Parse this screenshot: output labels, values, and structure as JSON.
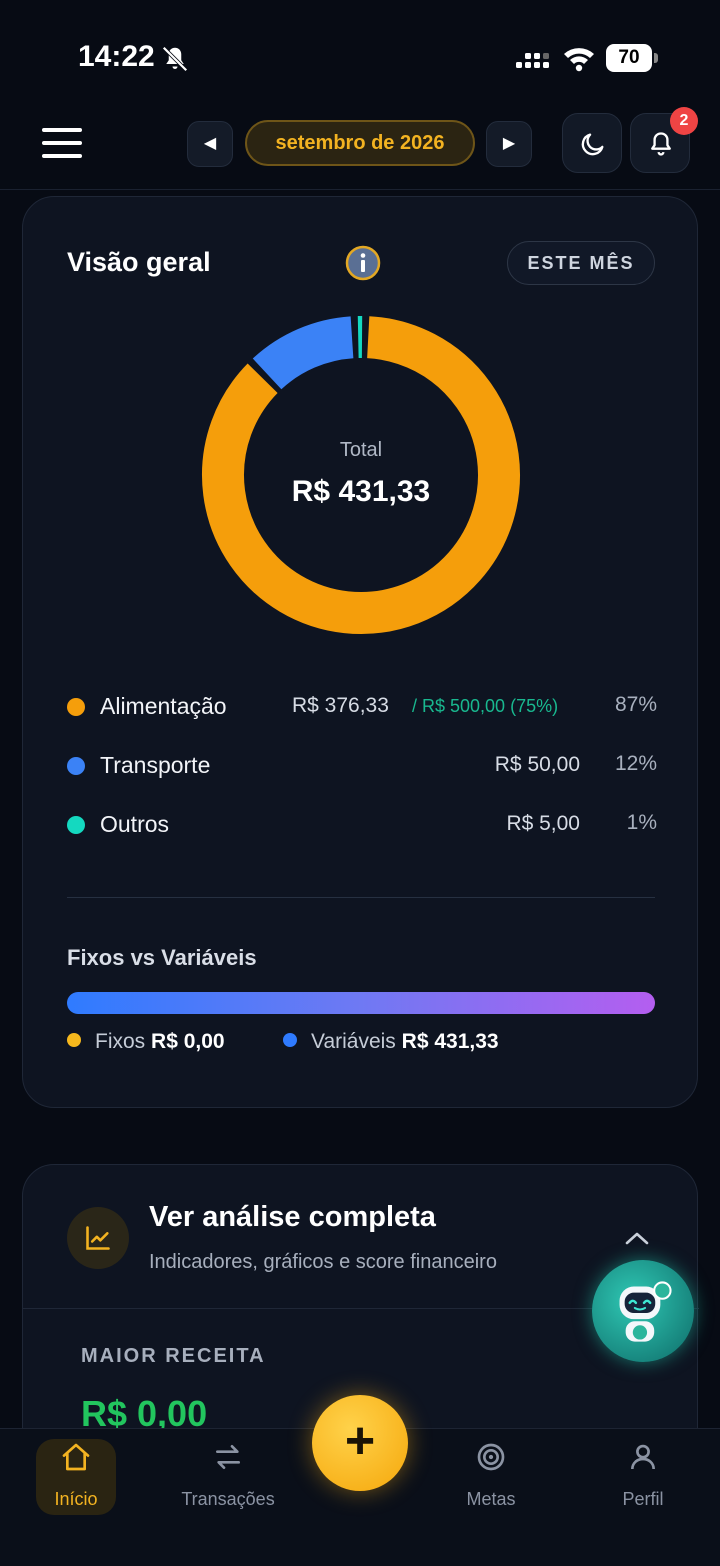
{
  "status_bar": {
    "time": "14:22",
    "battery": "70"
  },
  "header": {
    "month": "setembro de 2026",
    "prev_arrow": "◀",
    "next_arrow": "▶",
    "notification_count": "2"
  },
  "overview": {
    "title": "Visão geral",
    "period_label": "ESTE MÊS",
    "total_label": "Total",
    "total_value": "R$ 431,33",
    "categories": [
      {
        "name": "Alimentação",
        "amount": "R$ 376,33",
        "budget": "/ R$ 500,00 (75%)",
        "percent": "87%",
        "color": "#f59e0b"
      },
      {
        "name": "Transporte",
        "amount": "R$ 50,00",
        "budget": "",
        "percent": "12%",
        "color": "#3b82f6"
      },
      {
        "name": "Outros",
        "amount": "R$ 5,00",
        "budget": "",
        "percent": "1%",
        "color": "#14d9c0"
      }
    ],
    "fixed_vs_variable": {
      "title": "Fixos vs Variáveis",
      "fixed_label": "Fixos",
      "fixed_value": "R$ 0,00",
      "fixed_color": "#f6b81d",
      "variable_label": "Variáveis",
      "variable_value": "R$ 431,33",
      "variable_color": "#2f7bff"
    }
  },
  "chart_data": {
    "type": "pie",
    "categories": [
      "Alimentação",
      "Transporte",
      "Outros"
    ],
    "values": [
      376.33,
      50.0,
      5.0
    ],
    "colors": [
      "#f59e0b",
      "#3b82f6",
      "#14d9c0"
    ],
    "title": "Visão geral"
  },
  "analysis": {
    "title": "Ver análise completa",
    "subtitle": "Indicadores, gráficos e score financeiro",
    "maior_receita_label": "MAIOR RECEITA",
    "maior_receita_value": "R$ 0,00"
  },
  "tabs": [
    {
      "label": "Início",
      "icon": "home-icon"
    },
    {
      "label": "Transações",
      "icon": "transfer-icon"
    },
    {
      "label": "Metas",
      "icon": "target-icon"
    },
    {
      "label": "Perfil",
      "icon": "person-icon"
    }
  ],
  "colors": {
    "accent": "#f3b321",
    "background": "#070b14",
    "card": "#0e1421"
  }
}
